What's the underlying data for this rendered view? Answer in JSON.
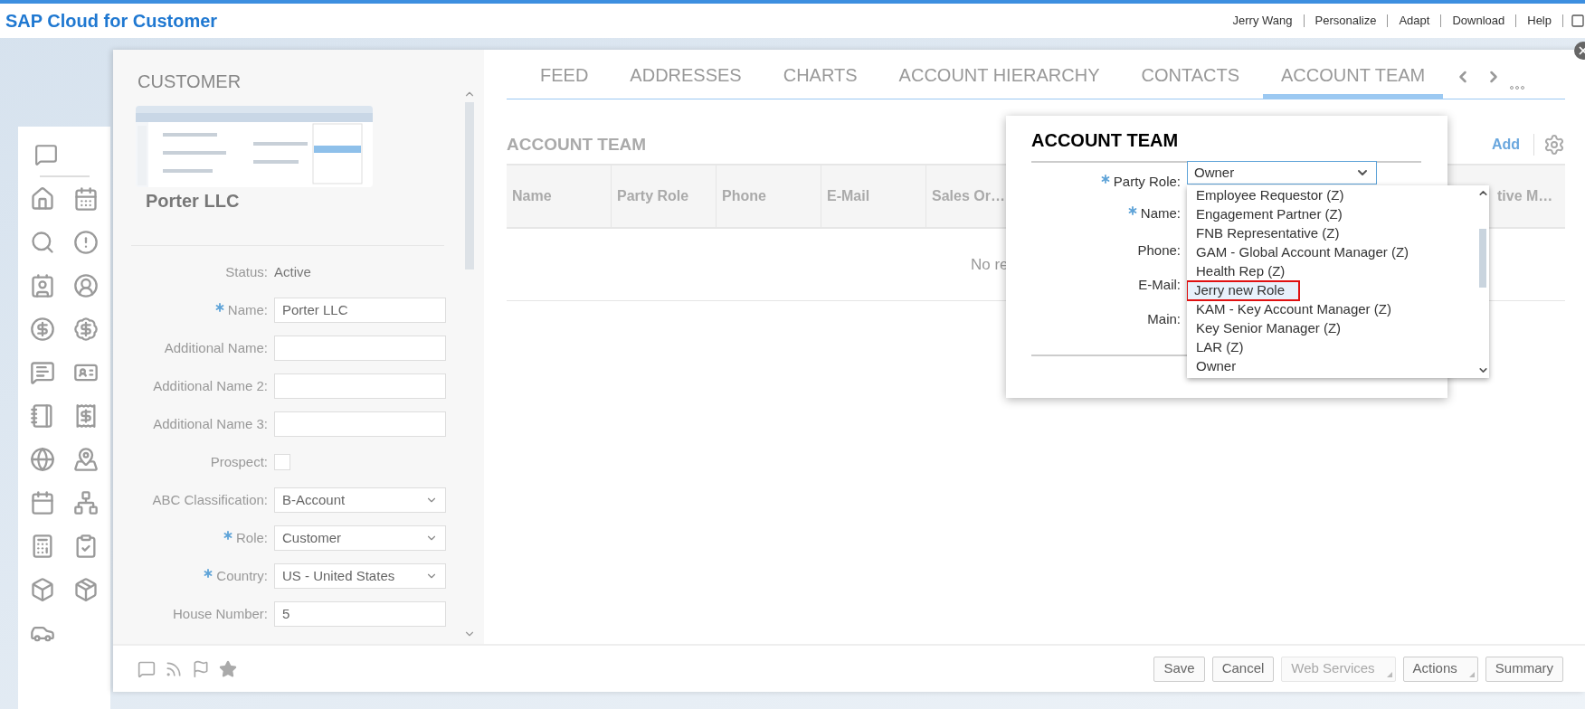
{
  "header": {
    "title": "SAP Cloud for Customer",
    "links": [
      "Jerry Wang",
      "Personalize",
      "Adapt",
      "Download",
      "Help"
    ]
  },
  "customer": {
    "title": "CUSTOMER",
    "name": "Porter LLC",
    "fields": [
      {
        "kind": "text",
        "label": "Status:",
        "required": false,
        "value": "Active"
      },
      {
        "kind": "input",
        "label": "Name:",
        "required": true,
        "value": "Porter LLC"
      },
      {
        "kind": "input",
        "label": "Additional Name:",
        "required": false
      },
      {
        "kind": "input",
        "label": "Additional Name 2:",
        "required": false
      },
      {
        "kind": "input",
        "label": "Additional Name 3:",
        "required": false
      },
      {
        "kind": "checkbox",
        "label": "Prospect:",
        "required": false,
        "checked": false
      },
      {
        "kind": "select",
        "label": "ABC Classification:",
        "required": false,
        "value": "B-Account"
      },
      {
        "kind": "select",
        "label": "Role:",
        "required": true,
        "value": "Customer"
      },
      {
        "kind": "select",
        "label": "Country:",
        "required": true,
        "value": "US - United States"
      },
      {
        "kind": "input",
        "label": "House Number:",
        "required": false,
        "value": "5"
      }
    ]
  },
  "tabs": [
    {
      "label": "FEED",
      "selected": false
    },
    {
      "label": "ADDRESSES",
      "selected": false
    },
    {
      "label": "CHARTS",
      "selected": false
    },
    {
      "label": "ACCOUNT HIERARCHY",
      "selected": false
    },
    {
      "label": "CONTACTS",
      "selected": false
    },
    {
      "label": "ACCOUNT TEAM",
      "selected": true
    }
  ],
  "section": {
    "title": "ACCOUNT TEAM",
    "add": "Add",
    "columns": [
      "Name",
      "Party Role",
      "Phone",
      "E-Mail",
      "Sales Or…"
    ],
    "column_last": "tive M…",
    "empty": "No re"
  },
  "dialog": {
    "title": "ACCOUNT TEAM",
    "fields": [
      {
        "label": "Party Role:",
        "required": true
      },
      {
        "label": "Name:",
        "required": true
      },
      {
        "label": "Phone:",
        "required": false
      },
      {
        "label": "E-Mail:",
        "required": false
      },
      {
        "label": "Main:",
        "required": false
      }
    ],
    "party_role_value": "Owner",
    "options": [
      {
        "label": "Employee Requestor (Z)",
        "selected": false,
        "outlined": false
      },
      {
        "label": "Engagement Partner (Z)",
        "selected": false,
        "outlined": false
      },
      {
        "label": "FNB Representative (Z)",
        "selected": false,
        "outlined": false
      },
      {
        "label": "GAM - Global Account Manager (Z)",
        "selected": false,
        "outlined": false
      },
      {
        "label": "Health Rep (Z)",
        "selected": false,
        "outlined": false
      },
      {
        "label": "Jerry new Role",
        "selected": true,
        "outlined": true
      },
      {
        "label": "KAM - Key Account Manager (Z)",
        "selected": false,
        "outlined": false
      },
      {
        "label": "Key Senior Manager (Z)",
        "selected": false,
        "outlined": false
      },
      {
        "label": "LAR (Z)",
        "selected": false,
        "outlined": false
      },
      {
        "label": "Owner",
        "selected": false,
        "outlined": false
      }
    ]
  },
  "footer_buttons": [
    {
      "label": "Save",
      "disabled": false,
      "menu": false
    },
    {
      "label": "Cancel",
      "disabled": false,
      "menu": false
    },
    {
      "label": "Web Services",
      "disabled": true,
      "menu": true
    },
    {
      "label": "Actions",
      "disabled": false,
      "menu": true
    },
    {
      "label": "Summary",
      "disabled": false,
      "menu": false
    }
  ]
}
